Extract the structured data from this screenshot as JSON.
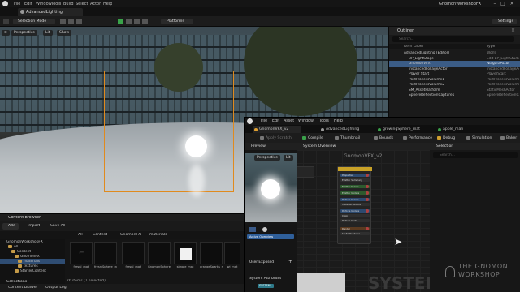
{
  "app": {
    "menus": [
      "File",
      "Edit",
      "Window",
      "Tools",
      "Build",
      "Select",
      "Actor",
      "Help"
    ],
    "project_name": "GnomonWorkshopFX",
    "level_tab": "AdvancedLighting"
  },
  "toolbar": {
    "selection_mode": "Selection Mode",
    "platforms": "Platforms",
    "settings": "Settings"
  },
  "viewport": {
    "perspective": "Perspective",
    "lit": "Lit",
    "show": "Show"
  },
  "outliner": {
    "title": "Outliner",
    "search_placeholder": "Search...",
    "col_label": "Item Label",
    "col_type": "Type",
    "rows": [
      {
        "label": "AdvancedLighting (Editor)",
        "type": "World"
      },
      {
        "label": "BP_LightStage",
        "type": "Edit BP_LightStudio"
      },
      {
        "label": "GnomonVFX",
        "type": "NiagaraActor",
        "selected": true
      },
      {
        "label": "InstancedFoliageActor",
        "type": "InstancedFoliageActor"
      },
      {
        "label": "Player Start",
        "type": "PlayerStart"
      },
      {
        "label": "PostProcessVolume1",
        "type": "PostProcessVolume"
      },
      {
        "label": "PostProcessVolume2",
        "type": "PostProcessVolume"
      },
      {
        "label": "SM_AssetPlatform",
        "type": "StaticMeshActor"
      },
      {
        "label": "SphereReflectionCapture1",
        "type": "SphereReflectionCapture"
      }
    ]
  },
  "content_browser": {
    "title": "Content Browser",
    "add": "Add",
    "import": "Import",
    "save_all": "Save All",
    "breadcrumb": [
      "All",
      "Content",
      "GnomonFX",
      "materials"
    ],
    "tree": [
      {
        "label": "GnomonWorkshopFX",
        "depth": 0
      },
      {
        "label": "All",
        "depth": 1
      },
      {
        "label": "Content",
        "depth": 2
      },
      {
        "label": "GnomonFX",
        "depth": 3
      },
      {
        "label": "materials",
        "depth": 4,
        "selected": true
      },
      {
        "label": "textures",
        "depth": 4
      },
      {
        "label": "StarterContent",
        "depth": 3
      }
    ],
    "collections": "Collections",
    "assets": [
      "fresnl_mat",
      "fresnlSphere_mat",
      "fresnl_mat",
      "GnomonSphere_mat",
      "simple_mat",
      "orangeSparks_mat",
      "wi_mat"
    ],
    "status": "76 items (1 selected)",
    "content_drawer": "Content Drawer",
    "output_log": "Output Log"
  },
  "niagara": {
    "menus": [
      "File",
      "Edit",
      "Asset",
      "Window",
      "Tools",
      "Help"
    ],
    "tabs": [
      {
        "label": "GnomonVFX_v2",
        "color": "#e0a030"
      },
      {
        "label": "AdvancedLighting",
        "color": "#9a9a9a"
      },
      {
        "label": "growingSphere_mat",
        "color": "#3aa04a"
      },
      {
        "label": "apple_man",
        "color": "#3aa04a"
      }
    ],
    "tools": [
      "Apply Scratch",
      "Compile",
      "Thumbnail",
      "Bounds",
      "Performance",
      "Debug",
      "Simulation",
      "Baker"
    ],
    "preview_title": "Preview",
    "preview_perspective": "Perspective",
    "preview_lit": "Lit",
    "system_overview": "System Overview",
    "system_name": "GnomonVFX_v2",
    "selection_title": "Selection",
    "selection_placeholder": "Search...",
    "params": {
      "active_overview": "Active Overview",
      "user_exposed": "User Exposed",
      "system_attributes": "System Attributes",
      "system_badge": "SYSTEM"
    },
    "node_rows": [
      "Properties",
      "Emitter Summary",
      "Emitter Spawn",
      "Emitter Update",
      "Particle Spawn",
      "Initialize Particle",
      "Particle Update",
      "Color",
      "Particle State",
      "Render",
      "Sprite Renderer"
    ],
    "watermark": "SYSTEM"
  },
  "branding": {
    "line1": "THE GNOMON",
    "line2": "WORKSHOP"
  }
}
